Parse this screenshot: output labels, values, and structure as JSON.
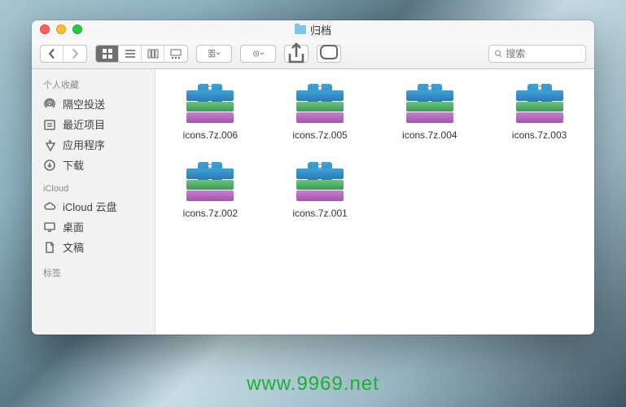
{
  "window": {
    "title": "归档"
  },
  "toolbar": {
    "search_placeholder": "搜索"
  },
  "sidebar": {
    "sections": [
      {
        "label": "个人收藏",
        "items": [
          {
            "label": "隔空投送"
          },
          {
            "label": "最近项目"
          },
          {
            "label": "应用程序"
          },
          {
            "label": "下载"
          }
        ]
      },
      {
        "label": "iCloud",
        "items": [
          {
            "label": "iCloud 云盘"
          },
          {
            "label": "桌面"
          },
          {
            "label": "文稿"
          }
        ]
      },
      {
        "label": "标签",
        "items": []
      }
    ]
  },
  "files": [
    {
      "name": "icons.7z.006"
    },
    {
      "name": "icons.7z.005"
    },
    {
      "name": "icons.7z.004"
    },
    {
      "name": "icons.7z.003"
    },
    {
      "name": "icons.7z.002"
    },
    {
      "name": "icons.7z.001"
    }
  ],
  "watermark": "www.9969.net"
}
